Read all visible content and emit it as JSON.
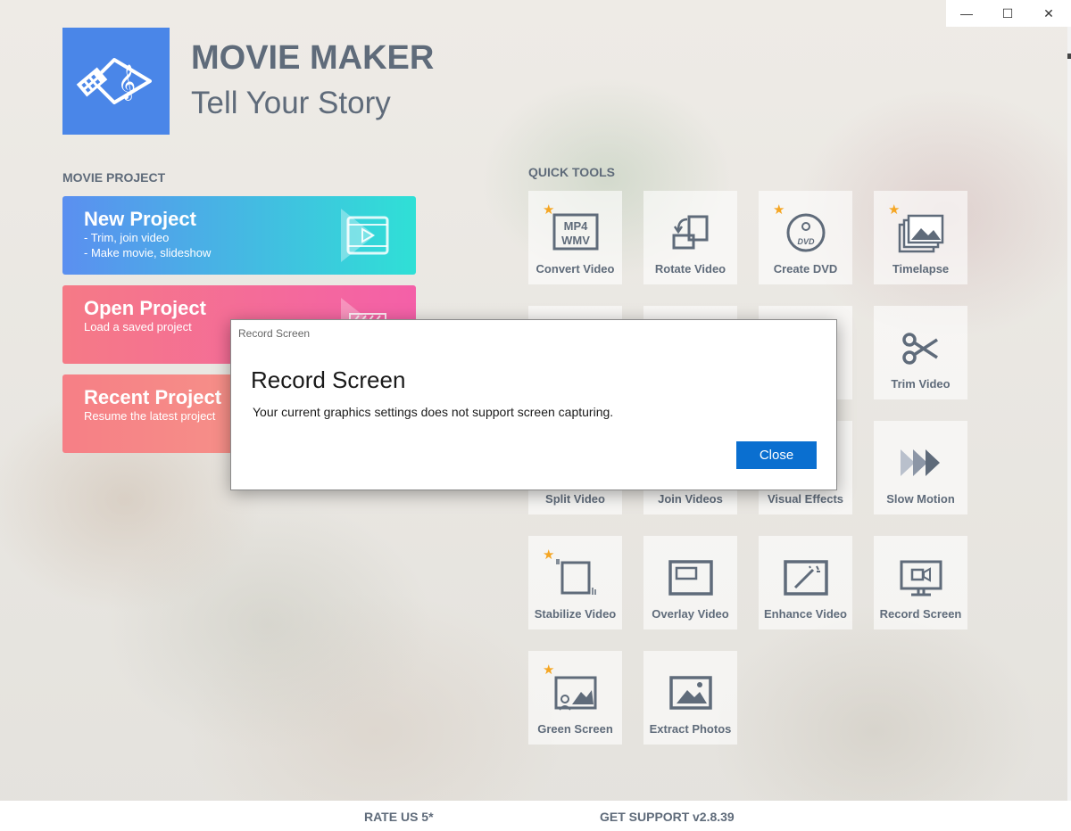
{
  "app": {
    "title": "MOVIE MAKER",
    "subtitle": "Tell Your Story"
  },
  "window_controls": {
    "minimize": "—",
    "maximize": "☐",
    "close": "✕"
  },
  "movie_project": {
    "section_label": "MOVIE PROJECT",
    "new": {
      "title": "New Project",
      "line1": "- Trim, join video",
      "line2": "- Make movie, slideshow"
    },
    "open": {
      "title": "Open Project",
      "line1": "Load a saved project"
    },
    "recent": {
      "title": "Recent Project",
      "line1": "Resume the latest project"
    }
  },
  "quick_tools": {
    "section_label": "QUICK TOOLS",
    "tiles": [
      {
        "label": "Convert Video",
        "icon": "mp4-wmv-icon",
        "starred": true
      },
      {
        "label": "Rotate Video",
        "icon": "rotate-icon",
        "starred": false
      },
      {
        "label": "Create DVD",
        "icon": "dvd-icon",
        "starred": true
      },
      {
        "label": "Timelapse",
        "icon": "timelapse-icon",
        "starred": true
      },
      {
        "label": "Trim Video",
        "icon": "scissors-icon",
        "starred": false
      },
      {
        "label": "Split Video",
        "icon": "split-icon",
        "starred": false
      },
      {
        "label": "Join Videos",
        "icon": "join-icon",
        "starred": false
      },
      {
        "label": "Visual Effects",
        "icon": "effects-icon",
        "starred": false
      },
      {
        "label": "Slow Motion",
        "icon": "slow-motion-icon",
        "starred": false
      },
      {
        "label": "Stabilize Video",
        "icon": "stabilize-icon",
        "starred": true
      },
      {
        "label": "Overlay Video",
        "icon": "overlay-icon",
        "starred": false
      },
      {
        "label": "Enhance Video",
        "icon": "enhance-icon",
        "starred": false
      },
      {
        "label": "Record Screen",
        "icon": "monitor-camera-icon",
        "starred": false
      },
      {
        "label": "Green Screen",
        "icon": "green-screen-icon",
        "starred": true
      },
      {
        "label": "Extract Photos",
        "icon": "photo-icon",
        "starred": false
      }
    ],
    "mp4_text": "MP4",
    "wmv_text": "WMV",
    "dvd_text": "DVD"
  },
  "footer": {
    "rate": "RATE US 5*",
    "support": "GET SUPPORT",
    "version": "v2.8.39"
  },
  "dialog": {
    "caption": "Record Screen",
    "title": "Record Screen",
    "message": "Your current graphics settings does not support screen capturing.",
    "close_label": "Close"
  },
  "colors": {
    "accent": "#4a86e8",
    "button": "#0a6fd0",
    "star": "#f5a623",
    "text": "#5f6b7a"
  }
}
